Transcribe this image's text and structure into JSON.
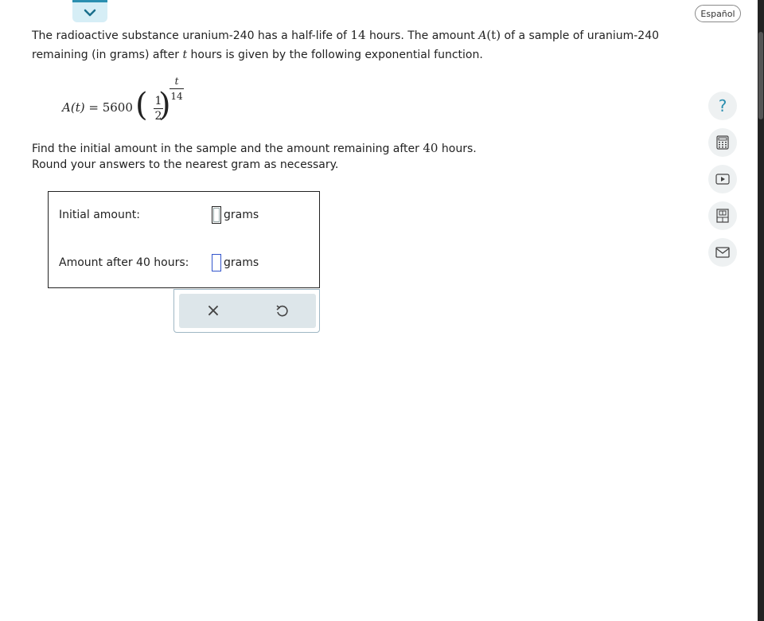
{
  "header": {
    "language_button": "Español"
  },
  "problem": {
    "part1": "The radioactive substance uranium-240 has a half-life of ",
    "half_life_value": "14",
    "part2": " hours. The amount ",
    "func_name": "A",
    "func_arg": "(t)",
    "part3": " of a sample of uranium-240 remaining (in grams) after ",
    "var_t": "t",
    "part4": " hours is given by the following exponential function."
  },
  "equation": {
    "lhs_func": "A",
    "lhs_arg": "(t)",
    "equals": " = ",
    "coefficient": "5600",
    "base_numerator": "1",
    "base_denominator": "2",
    "exponent_numerator": "t",
    "exponent_denominator": "14"
  },
  "instructions": {
    "line1_a": "Find the initial amount in the sample and the amount remaining after ",
    "line1_hours": "40",
    "line1_b": " hours.",
    "line2": "Round your answers to the nearest gram as necessary."
  },
  "answers": {
    "initial_label": "Initial amount:",
    "initial_value": "",
    "initial_unit": "grams",
    "after_label": "Amount after 40 hours:",
    "after_value": "",
    "after_unit": "grams"
  },
  "actions": {
    "clear_symbol": "×",
    "undo_icon": "undo-icon"
  },
  "side_tools": [
    "help-icon",
    "calculator-icon",
    "video-icon",
    "textbook-icon",
    "mail-icon"
  ],
  "colors": {
    "accent": "#2b8fb0",
    "input_border": "#3355cc",
    "action_bg": "#dde6ea"
  }
}
